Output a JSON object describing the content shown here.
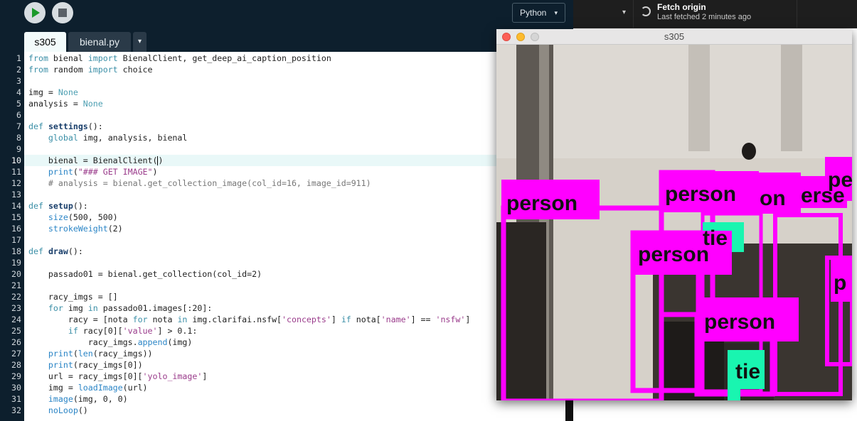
{
  "toolbar": {
    "run_icon": "play-icon",
    "stop_icon": "stop-icon",
    "language": "Python",
    "language_caret": "▾"
  },
  "git": {
    "branch_caret": "▾",
    "fetch_title": "Fetch origin",
    "fetch_subtitle": "Last fetched 2 minutes ago",
    "fetch_icon": "sync-icon"
  },
  "tabs": [
    {
      "label": "s305",
      "active": true
    },
    {
      "label": "bienal.py",
      "active": false
    }
  ],
  "tab_more": "▾",
  "editor": {
    "active_line": 10,
    "lines": [
      {
        "n": "1",
        "html": "<span class='kw'>from</span> bienal <span class='kw'>import</span> BienalClient, get_deep_ai_caption_position"
      },
      {
        "n": "2",
        "html": "<span class='kw'>from</span> random <span class='kw'>import</span> choice"
      },
      {
        "n": "3",
        "html": ""
      },
      {
        "n": "4",
        "html": "img = <span class='none'>None</span>"
      },
      {
        "n": "5",
        "html": "analysis = <span class='none'>None</span>"
      },
      {
        "n": "6",
        "html": ""
      },
      {
        "n": "7",
        "html": "<span class='kw'>def</span> <span class='fn'>settings</span>():"
      },
      {
        "n": "8",
        "html": "    <span class='kw'>global</span> img, analysis, bienal"
      },
      {
        "n": "9",
        "html": ""
      },
      {
        "n": "10",
        "html": "    bienal = BienalClient(<span class='cursor'></span>)"
      },
      {
        "n": "11",
        "html": "    <span class='bi'>print</span>(<span class='st'>\"### GET IMAGE\"</span>)"
      },
      {
        "n": "12",
        "html": "    <span class='cm'># analysis = bienal.get_collection_image(col_id=16, image_id=911)</span>"
      },
      {
        "n": "13",
        "html": ""
      },
      {
        "n": "14",
        "html": "<span class='kw'>def</span> <span class='fn'>setup</span>():"
      },
      {
        "n": "15",
        "html": "    <span class='bi'>size</span>(500, 500)"
      },
      {
        "n": "16",
        "html": "    <span class='bi'>strokeWeight</span>(2)"
      },
      {
        "n": "17",
        "html": ""
      },
      {
        "n": "18",
        "html": "<span class='kw'>def</span> <span class='fn'>draw</span>():"
      },
      {
        "n": "19",
        "html": ""
      },
      {
        "n": "20",
        "html": "    passado01 = bienal.get_collection(col_id=2)"
      },
      {
        "n": "21",
        "html": ""
      },
      {
        "n": "22",
        "html": "    racy_imgs = []"
      },
      {
        "n": "23",
        "html": "    <span class='kw'>for</span> img <span class='kw'>in</span> passado01.images[:20]:"
      },
      {
        "n": "24",
        "html": "        racy = [nota <span class='kw'>for</span> nota <span class='kw'>in</span> img.clarifai.nsfw[<span class='st'>'concepts'</span>] <span class='kw'>if</span> nota[<span class='st'>'name'</span>] == <span class='st'>'nsfw'</span>]"
      },
      {
        "n": "25",
        "html": "        <span class='kw'>if</span> racy[0][<span class='st'>'value'</span>] > 0.1:"
      },
      {
        "n": "26",
        "html": "            racy_imgs.<span class='bi'>append</span>(img)"
      },
      {
        "n": "27",
        "html": "    <span class='bi'>print</span>(<span class='bi'>len</span>(racy_imgs))"
      },
      {
        "n": "28",
        "html": "    <span class='bi'>print</span>(racy_imgs[0])"
      },
      {
        "n": "29",
        "html": "    url = racy_imgs[0][<span class='st'>'yolo_image'</span>]"
      },
      {
        "n": "30",
        "html": "    img = <span class='bi'>loadImage</span>(url)"
      },
      {
        "n": "31",
        "html": "    <span class='bi'>image</span>(img, 0, 0)"
      },
      {
        "n": "32",
        "html": "    <span class='bi'>noLoop</span>()"
      }
    ]
  },
  "sketch": {
    "title": "s305",
    "window_controls": [
      "close-dot",
      "minimize-dot",
      "zoom-dot"
    ],
    "labels": [
      "person",
      "person",
      "person",
      "person",
      "tie",
      "tie",
      "on",
      "erse",
      "pe",
      "p"
    ],
    "colors": {
      "person_box": "#ff00ff",
      "tie_box": "#19f5b0",
      "photo_tone": "#d8d3cb"
    }
  }
}
